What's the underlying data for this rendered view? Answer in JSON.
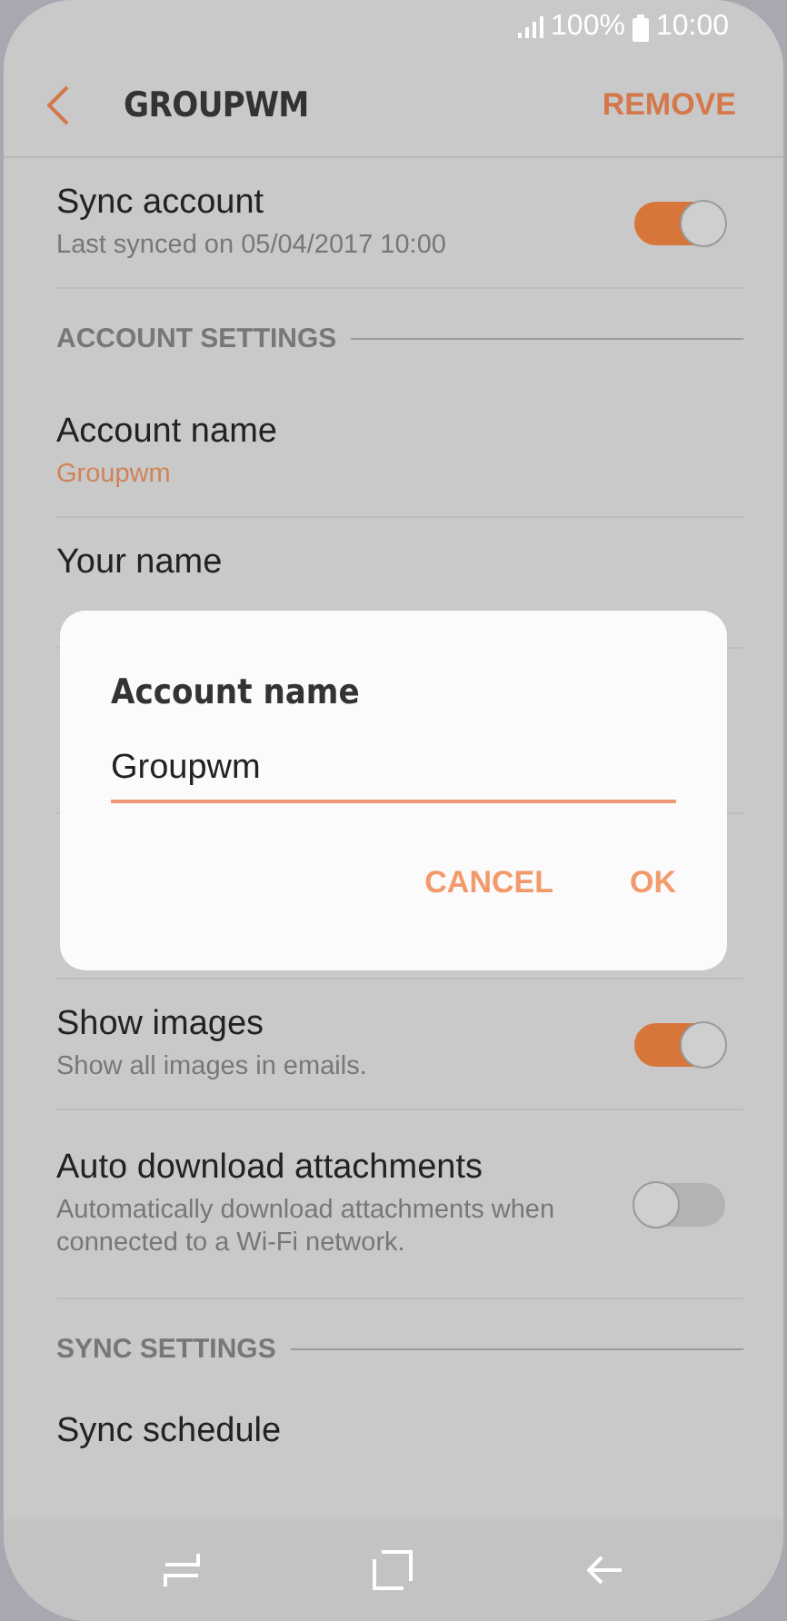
{
  "status_bar": {
    "battery": "100%",
    "time": "10:00"
  },
  "header": {
    "title": "GROUPWM",
    "action": "REMOVE"
  },
  "sections": [
    {
      "kind": "rows",
      "rows": [
        {
          "kind": "switch",
          "title": "Sync account",
          "subtitle": "Last synced on 05/04/2017  10:00",
          "toggle": {
            "on": true
          }
        }
      ]
    },
    {
      "kind": "heading",
      "label": "ACCOUNT SETTINGS"
    },
    {
      "kind": "rows",
      "rows": [
        {
          "kind": "value",
          "title": "Account name",
          "subtitle": "Groupwm"
        },
        {
          "kind": "value",
          "title": "Your name"
        },
        {
          "kind": "value"
        },
        {
          "kind": "value"
        },
        {
          "kind": "switch",
          "title": "Show images",
          "subtitle": "Show all images in emails.",
          "toggle": {
            "on": true
          }
        },
        {
          "kind": "switch",
          "title": "Auto download attachments",
          "subtitle": "Automatically download attachments when connected to a Wi-Fi network.",
          "toggle": {
            "on": false
          }
        }
      ]
    },
    {
      "kind": "heading",
      "label": "SYNC SETTINGS"
    },
    {
      "kind": "rows",
      "rows": [
        {
          "kind": "value",
          "title": "Sync schedule"
        }
      ]
    }
  ],
  "dialog": {
    "title": "Account name",
    "value": "Groupwm",
    "buttons": [
      "CANCEL",
      "OK"
    ]
  }
}
